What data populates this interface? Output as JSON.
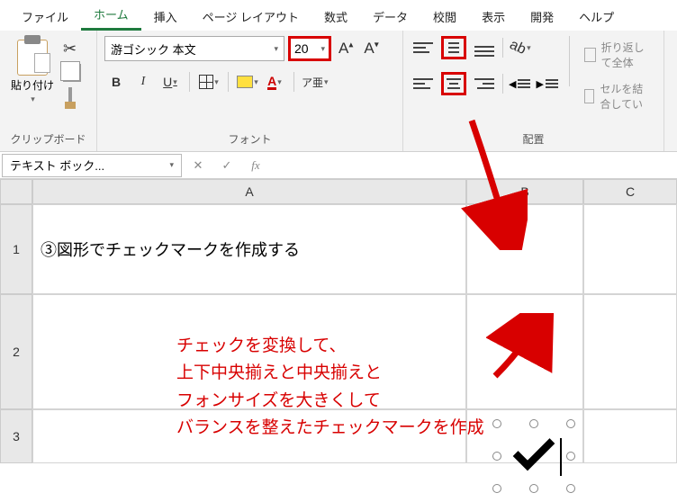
{
  "tabs": {
    "file": "ファイル",
    "home": "ホーム",
    "insert": "挿入",
    "pagelayout": "ページ レイアウト",
    "formulas": "数式",
    "data": "データ",
    "review": "校閲",
    "view": "表示",
    "developer": "開発",
    "help": "ヘルプ"
  },
  "ribbon": {
    "clipboard": {
      "paste": "貼り付け",
      "label": "クリップボード"
    },
    "font": {
      "name": "游ゴシック 本文",
      "size": "20",
      "grow": "A^",
      "shrink": "A˅",
      "bold": "B",
      "italic": "I",
      "underline": "U",
      "fontcolor": "A",
      "ruby": "ア亜",
      "label": "フォント"
    },
    "align": {
      "wrap": "折り返して全体",
      "merge": "セルを結合してい",
      "label": "配置"
    }
  },
  "namebox": "テキスト ボック...",
  "fx": "fx",
  "cols": {
    "A": "A",
    "B": "B",
    "C": "C"
  },
  "rows": {
    "r1": "1",
    "r2": "2",
    "r3": "3"
  },
  "cells": {
    "A1": "③図形でチェックマークを作成する"
  },
  "annotation": {
    "l1": "チェックを変換して、",
    "l2": "上下中央揃えと中央揃えと",
    "l3": "フォンサイズを大きくして",
    "l4": "バランスを整えたチェックマークを作成"
  }
}
